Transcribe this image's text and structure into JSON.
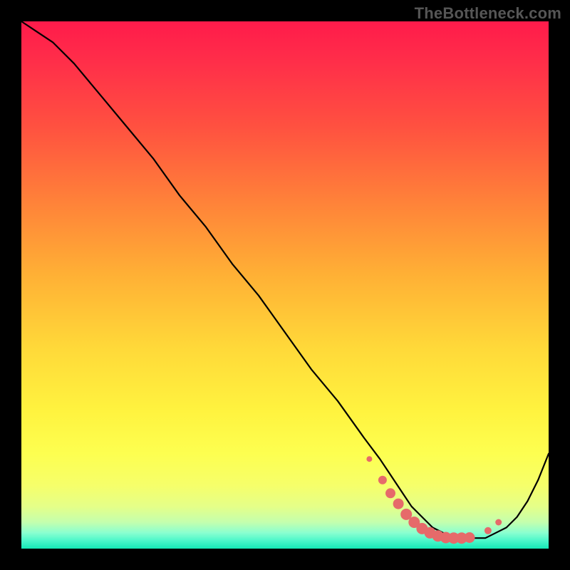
{
  "attribution": "TheBottleneck.com",
  "colors": {
    "marker": "#e66a6a",
    "line": "#000000",
    "frame_bg": "#000000"
  },
  "chart_data": {
    "type": "line",
    "title": "",
    "xlabel": "",
    "ylabel": "",
    "xlim": [
      0,
      100
    ],
    "ylim": [
      0,
      100
    ],
    "grid": false,
    "legend": false,
    "series": [
      {
        "name": "curve",
        "x": [
          0,
          3,
          6,
          10,
          15,
          20,
          25,
          30,
          35,
          40,
          45,
          50,
          55,
          60,
          65,
          68,
          70,
          72,
          74,
          76,
          78,
          80,
          82,
          84,
          86,
          88,
          90,
          92,
          94,
          96,
          98,
          100
        ],
        "y": [
          100,
          98,
          96,
          92,
          86,
          80,
          74,
          67,
          61,
          54,
          48,
          41,
          34,
          28,
          21,
          17,
          14,
          11,
          8,
          6,
          4,
          3,
          2,
          2,
          2,
          2,
          3,
          4,
          6,
          9,
          13,
          18
        ]
      }
    ],
    "markers": {
      "name": "highlight-cluster",
      "x": [
        66,
        68.5,
        70,
        71.5,
        73,
        74.5,
        76,
        77.5,
        79,
        80.5,
        82,
        83.5,
        85,
        88.5,
        90.5
      ],
      "y": [
        17,
        13,
        10.5,
        8.5,
        6.5,
        5,
        3.8,
        3,
        2.4,
        2.1,
        2,
        2,
        2.1,
        3.4,
        5
      ],
      "radius_px": [
        4,
        6,
        7,
        7.5,
        8,
        8,
        8,
        8,
        8,
        8,
        8,
        8,
        7.5,
        5,
        4.5
      ]
    },
    "gradient_stops": [
      {
        "pos": 0.0,
        "color": "#ff1b4b"
      },
      {
        "pos": 0.5,
        "color": "#ffd035"
      },
      {
        "pos": 0.8,
        "color": "#fcff48"
      },
      {
        "pos": 1.0,
        "color": "#15e9b6"
      }
    ]
  }
}
